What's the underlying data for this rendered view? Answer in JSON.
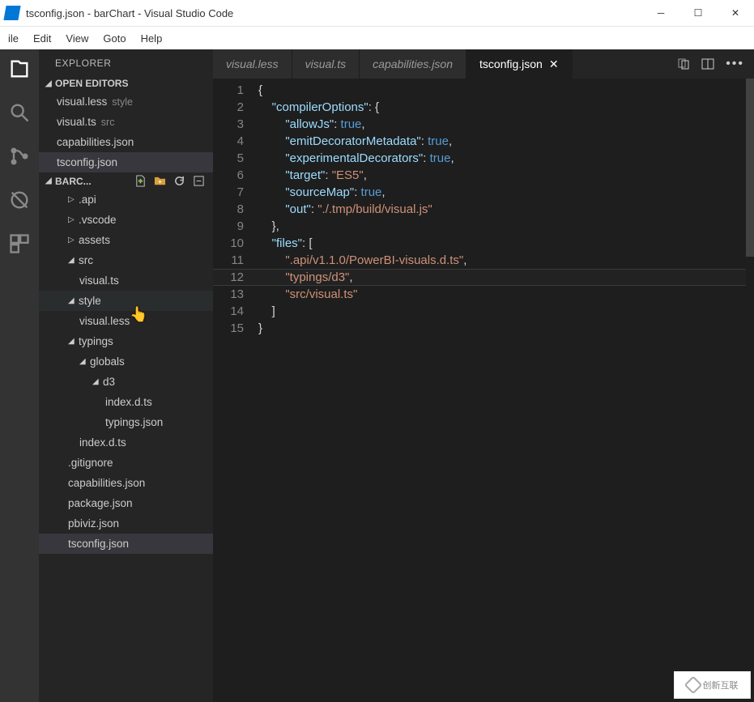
{
  "window": {
    "title": "tsconfig.json - barChart - Visual Studio Code"
  },
  "menu": [
    "ile",
    "Edit",
    "View",
    "Goto",
    "Help"
  ],
  "sidebar": {
    "title": "EXPLORER",
    "openEditors": {
      "label": "OPEN EDITORS",
      "items": [
        {
          "name": "visual.less",
          "dir": "style"
        },
        {
          "name": "visual.ts",
          "dir": "src"
        },
        {
          "name": "capabilities.json",
          "dir": ""
        },
        {
          "name": "tsconfig.json",
          "dir": ""
        }
      ]
    },
    "project": {
      "label": "BARC...",
      "tree": [
        {
          "t": "d",
          "n": ".api",
          "lvl": 2,
          "open": false
        },
        {
          "t": "d",
          "n": ".vscode",
          "lvl": 2,
          "open": false
        },
        {
          "t": "d",
          "n": "assets",
          "lvl": 2,
          "open": false
        },
        {
          "t": "d",
          "n": "src",
          "lvl": 2,
          "open": true
        },
        {
          "t": "f",
          "n": "visual.ts",
          "lvl": 3
        },
        {
          "t": "d",
          "n": "style",
          "lvl": 2,
          "open": true,
          "hov": true
        },
        {
          "t": "f",
          "n": "visual.less",
          "lvl": 3
        },
        {
          "t": "d",
          "n": "typings",
          "lvl": 2,
          "open": true
        },
        {
          "t": "d",
          "n": "globals",
          "lvl": 3,
          "open": true
        },
        {
          "t": "d",
          "n": "d3",
          "lvl": 4,
          "open": true
        },
        {
          "t": "f",
          "n": "index.d.ts",
          "lvl": 5
        },
        {
          "t": "f",
          "n": "typings.json",
          "lvl": 5
        },
        {
          "t": "f",
          "n": "index.d.ts",
          "lvl": 3
        },
        {
          "t": "f",
          "n": ".gitignore",
          "lvl": 2
        },
        {
          "t": "f",
          "n": "capabilities.json",
          "lvl": 2
        },
        {
          "t": "f",
          "n": "package.json",
          "lvl": 2
        },
        {
          "t": "f",
          "n": "pbiviz.json",
          "lvl": 2
        },
        {
          "t": "f",
          "n": "tsconfig.json",
          "lvl": 2,
          "sel": true
        }
      ]
    }
  },
  "tabs": [
    {
      "label": "visual.less",
      "active": false
    },
    {
      "label": "visual.ts",
      "active": false
    },
    {
      "label": "capabilities.json",
      "active": false
    },
    {
      "label": "tsconfig.json",
      "active": true
    }
  ],
  "code": {
    "lines": [
      "{",
      "    \"compilerOptions\": {",
      "        \"allowJs\": true,",
      "        \"emitDecoratorMetadata\": true,",
      "        \"experimentalDecorators\": true,",
      "        \"target\": \"ES5\",",
      "        \"sourceMap\": true,",
      "        \"out\": \"./.tmp/build/visual.js\"",
      "    },",
      "    \"files\": [",
      "        \".api/v1.1.0/PowerBI-visuals.d.ts\",",
      "        \"typings/d3\",",
      "        \"src/visual.ts\"",
      "    ]",
      "}"
    ]
  },
  "watermark": "创新互联"
}
